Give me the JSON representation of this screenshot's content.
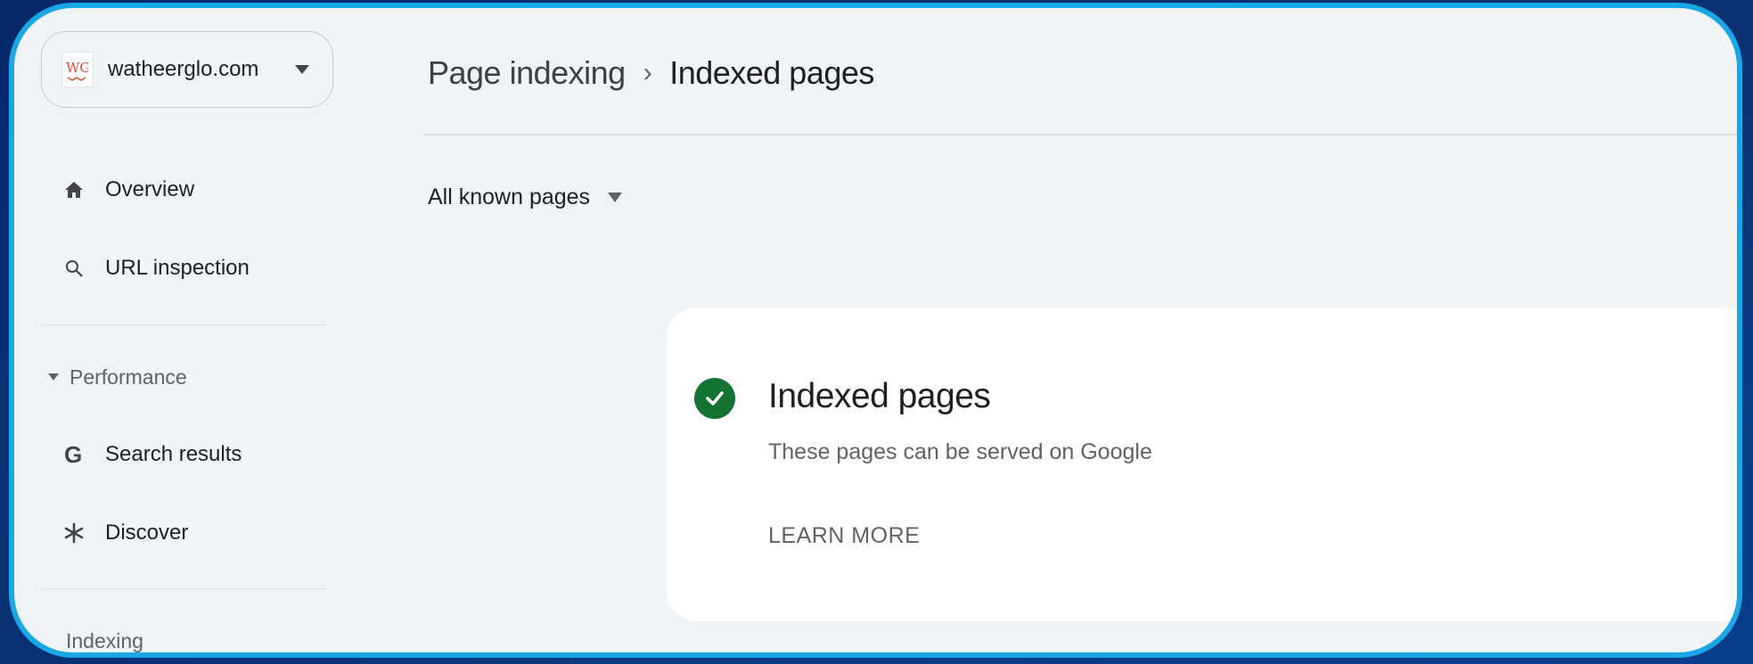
{
  "site": {
    "name": "watheerglo.com",
    "logo_text": "WG"
  },
  "sidebar": {
    "items_top": [
      {
        "label": "Overview",
        "icon": "home-icon"
      },
      {
        "label": "URL inspection",
        "icon": "search-icon"
      }
    ],
    "performance": {
      "heading": "Performance",
      "items": [
        {
          "label": "Search results",
          "icon": "google-g-icon"
        },
        {
          "label": "Discover",
          "icon": "asterisk-icon"
        }
      ]
    },
    "indexing": {
      "heading": "Indexing"
    }
  },
  "breadcrumb": {
    "parent": "Page indexing",
    "separator": "›",
    "current": "Indexed pages"
  },
  "filter": {
    "selected": "All known pages"
  },
  "card": {
    "title": "Indexed pages",
    "subtitle": "These pages can be served on Google",
    "learn_more": "LEARN MORE"
  },
  "colors": {
    "success": "#137333",
    "frame_border": "#1aa7e6",
    "page_bg": "#f0f4f9",
    "logo_red": "#d34d2f"
  }
}
